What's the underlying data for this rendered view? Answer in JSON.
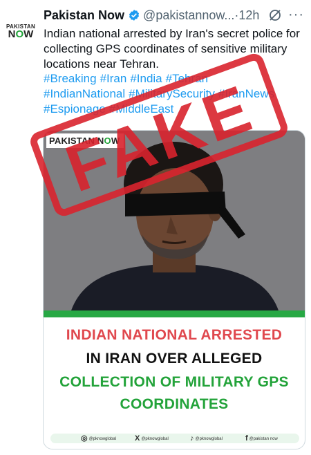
{
  "avatar": {
    "line1": "PAKISTAN",
    "line2a": "N",
    "line2b": "O",
    "line2c": "W"
  },
  "header": {
    "name": "Pakistan Now",
    "handle": "@pakistannow...",
    "separator": "·",
    "time": "12h",
    "more": "···"
  },
  "tweet": {
    "text": "Indian national arrested by Iran's secret police for collecting GPS coordinates of sensitive military locations near Tehran.",
    "hashtags": [
      "#Breaking",
      "#Iran",
      "#India",
      "#Tehran",
      "#IndianNational",
      "#MilitarySecurity",
      "#IranNews",
      "#Espionage",
      "#MiddleEast"
    ]
  },
  "card": {
    "logo_a": "PAKISTAN N",
    "logo_b": "O",
    "logo_c": "W",
    "headline_1": "INDIAN NATIONAL ARRESTED",
    "headline_2": "IN IRAN OVER ALLEGED",
    "headline_3": "COLLECTION OF MILITARY GPS",
    "headline_4": "COORDINATES",
    "socials": [
      {
        "glyph": "◎",
        "handle": "@pknowglobal",
        "icon": "instagram-icon"
      },
      {
        "glyph": "X",
        "handle": "@pknowglobal",
        "icon": "x-icon"
      },
      {
        "glyph": "♪",
        "handle": "@pknowglobal",
        "icon": "tiktok-icon"
      },
      {
        "glyph": "f",
        "handle": "@pakistan now",
        "icon": "facebook-icon"
      }
    ]
  },
  "stamp": {
    "text": "FAKE",
    "color": "#d9232d"
  },
  "colors": {
    "link": "#1d9bf0",
    "verified": "#1d9bf0",
    "brand_green": "#27a844",
    "headline_red": "#e0484e"
  }
}
